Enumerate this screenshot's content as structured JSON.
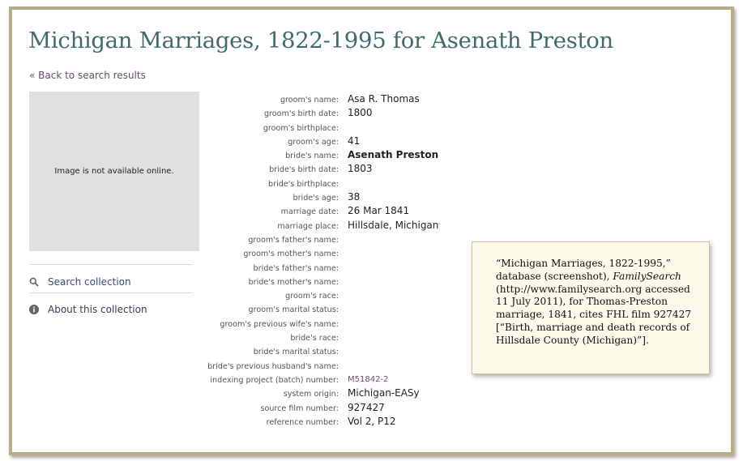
{
  "page": {
    "title": "Michigan Marriages, 1822-1995 for Asenath Preston",
    "back_link": "« Back to search results"
  },
  "image_panel": {
    "message": "Image is not available online."
  },
  "sidebar": {
    "search_label": "Search collection",
    "about_label": "About this collection"
  },
  "record": [
    {
      "label": "groom's name:",
      "value": "Asa R. Thomas"
    },
    {
      "label": "groom's birth date:",
      "value": "1800"
    },
    {
      "label": "groom's birthplace:",
      "value": ""
    },
    {
      "label": "groom's age:",
      "value": "41"
    },
    {
      "label": "bride's name:",
      "value": "Asenath Preston",
      "bold": true
    },
    {
      "label": "bride's birth date:",
      "value": "1803"
    },
    {
      "label": "bride's birthplace:",
      "value": ""
    },
    {
      "label": "bride's age:",
      "value": "38"
    },
    {
      "label": "marriage date:",
      "value": "26 Mar 1841"
    },
    {
      "label": "marriage place:",
      "value": "Hillsdale, Michigan"
    },
    {
      "label": "groom's father's name:",
      "value": ""
    },
    {
      "label": "groom's mother's name:",
      "value": ""
    },
    {
      "label": "bride's father's name:",
      "value": ""
    },
    {
      "label": "bride's mother's name:",
      "value": ""
    },
    {
      "label": "groom's race:",
      "value": ""
    },
    {
      "label": "groom's marital status:",
      "value": ""
    },
    {
      "label": "groom's previous wife's name:",
      "value": ""
    },
    {
      "label": "bride's race:",
      "value": ""
    },
    {
      "label": "bride's marital status:",
      "value": ""
    },
    {
      "label": "bride's previous husband's name:",
      "value": ""
    },
    {
      "label": "indexing project (batch) number:",
      "value": "M51842-2",
      "link": true
    },
    {
      "label": "system origin:",
      "value": "Michigan-EASy"
    },
    {
      "label": "source film number:",
      "value": "927427"
    },
    {
      "label": "reference number:",
      "value": "Vol 2, P12"
    }
  ],
  "citation": {
    "part1": "“Michigan Marriages, 1822-1995,” database (screenshot), ",
    "italic": "FamilySearch",
    "part2": " (http://www.familysearch.org accessed 11 July 2011), for Thomas-Preston marriage, 1841, cites FHL film 927427 [“Birth, marriage and death records of Hillsdale County (Michigan)”]."
  },
  "colors": {
    "frame_border": "#b8ad86",
    "title": "#3f6b6f",
    "link": "#6a4a6c",
    "note_bg": "#fcfbe9"
  },
  "icons": [
    "search-icon",
    "info-icon"
  ]
}
